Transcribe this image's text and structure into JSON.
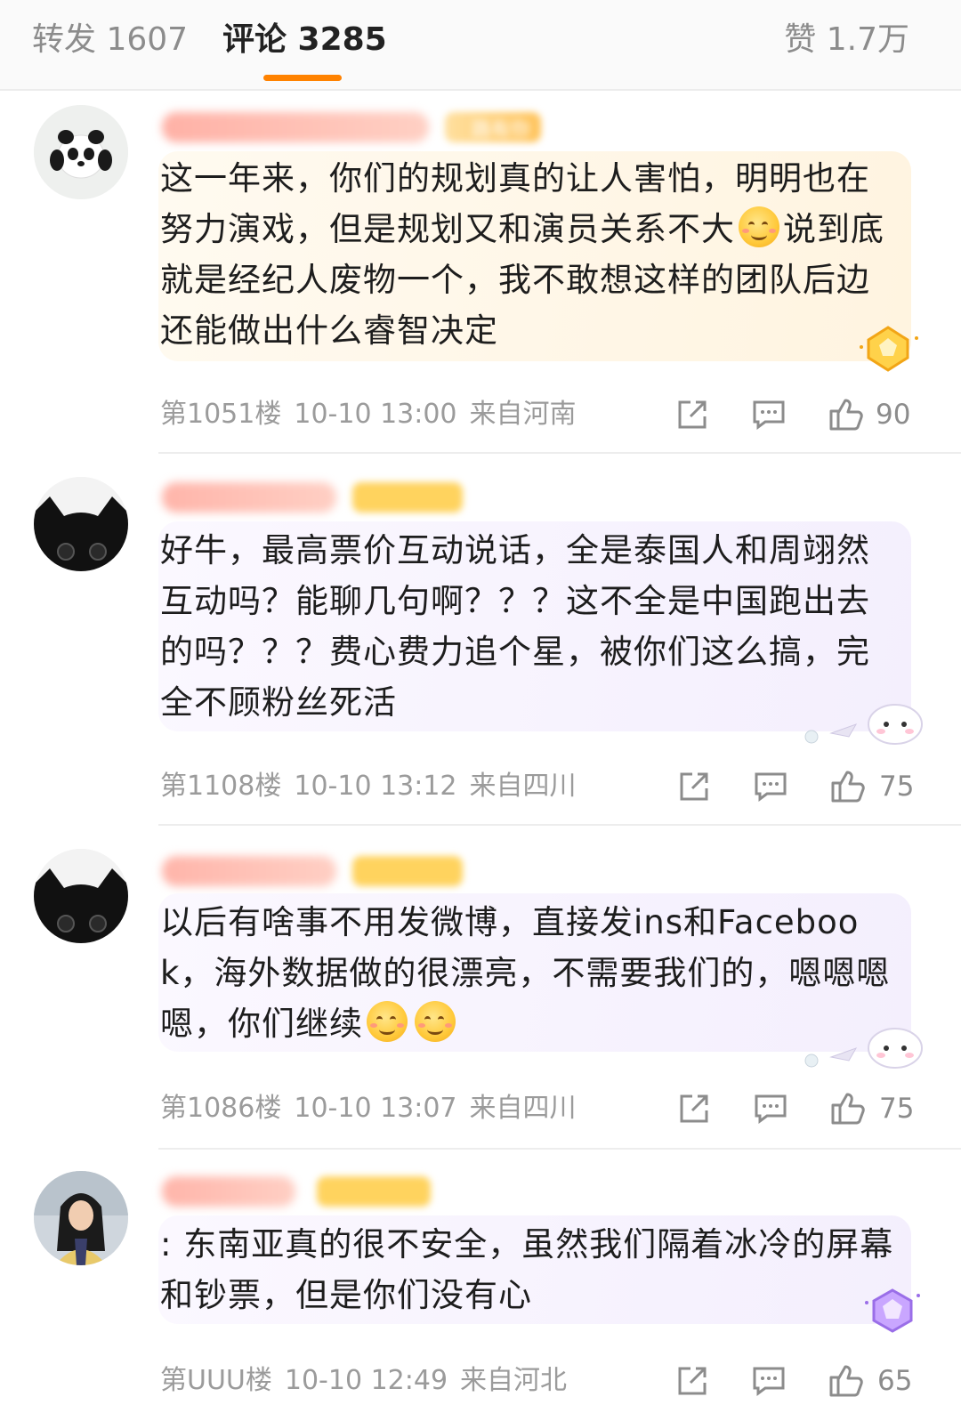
{
  "tabs": {
    "repost": "转发 1607",
    "comments": "评论 3285",
    "likes": "赞 1.7万"
  },
  "colors": {
    "accent": "#ff8200",
    "text_primary": "#1d1d1d",
    "text_meta": "#9b9b9b"
  },
  "comments": [
    {
      "text_a": "这一年来，你们的规划真的让人害怕，明明也在努力演戏，但是规划又和演员关系不大",
      "text_b": "说到底就是经纪人废物一个，我不敢想这样的团队后边还能做出什么睿智决定",
      "emojis": 1,
      "floor": "第1051楼",
      "time": "10-10 13:00",
      "location": "来自河南",
      "likes": "90",
      "avatar": "panda-avatar"
    },
    {
      "text_a": "好牛，最高票价互动说话，全是泰国人和周翊然互动吗？能聊几句啊？？？这不全是中国跑出去的吗？？？费心费力追个星，被你们这么搞，完全不顾粉丝死活",
      "text_b": "",
      "emojis": 0,
      "floor": "第1108楼",
      "time": "10-10 13:12",
      "location": "来自四川",
      "likes": "75",
      "avatar": "black-cat-avatar"
    },
    {
      "text_a": "以后有啥事不用发微博，直接发ins和Facebook，海外数据做的很漂亮，不需要我们的，嗯嗯嗯嗯，你们继续",
      "text_b": "",
      "emojis": 2,
      "floor": "第1086楼",
      "time": "10-10 13:07",
      "location": "来自四川",
      "likes": "75",
      "avatar": "black-cat-avatar"
    },
    {
      "text_a": ": 东南亚真的很不安全，虽然我们隔着冰冷的屏幕和钞票，但是你们没有心",
      "text_b": "",
      "emojis": 0,
      "floor": "第UUU楼",
      "time": "10-10 12:49",
      "location": "来自河北",
      "likes": "65",
      "avatar": "girl-photo-avatar"
    }
  ],
  "badge_text": "路有你"
}
